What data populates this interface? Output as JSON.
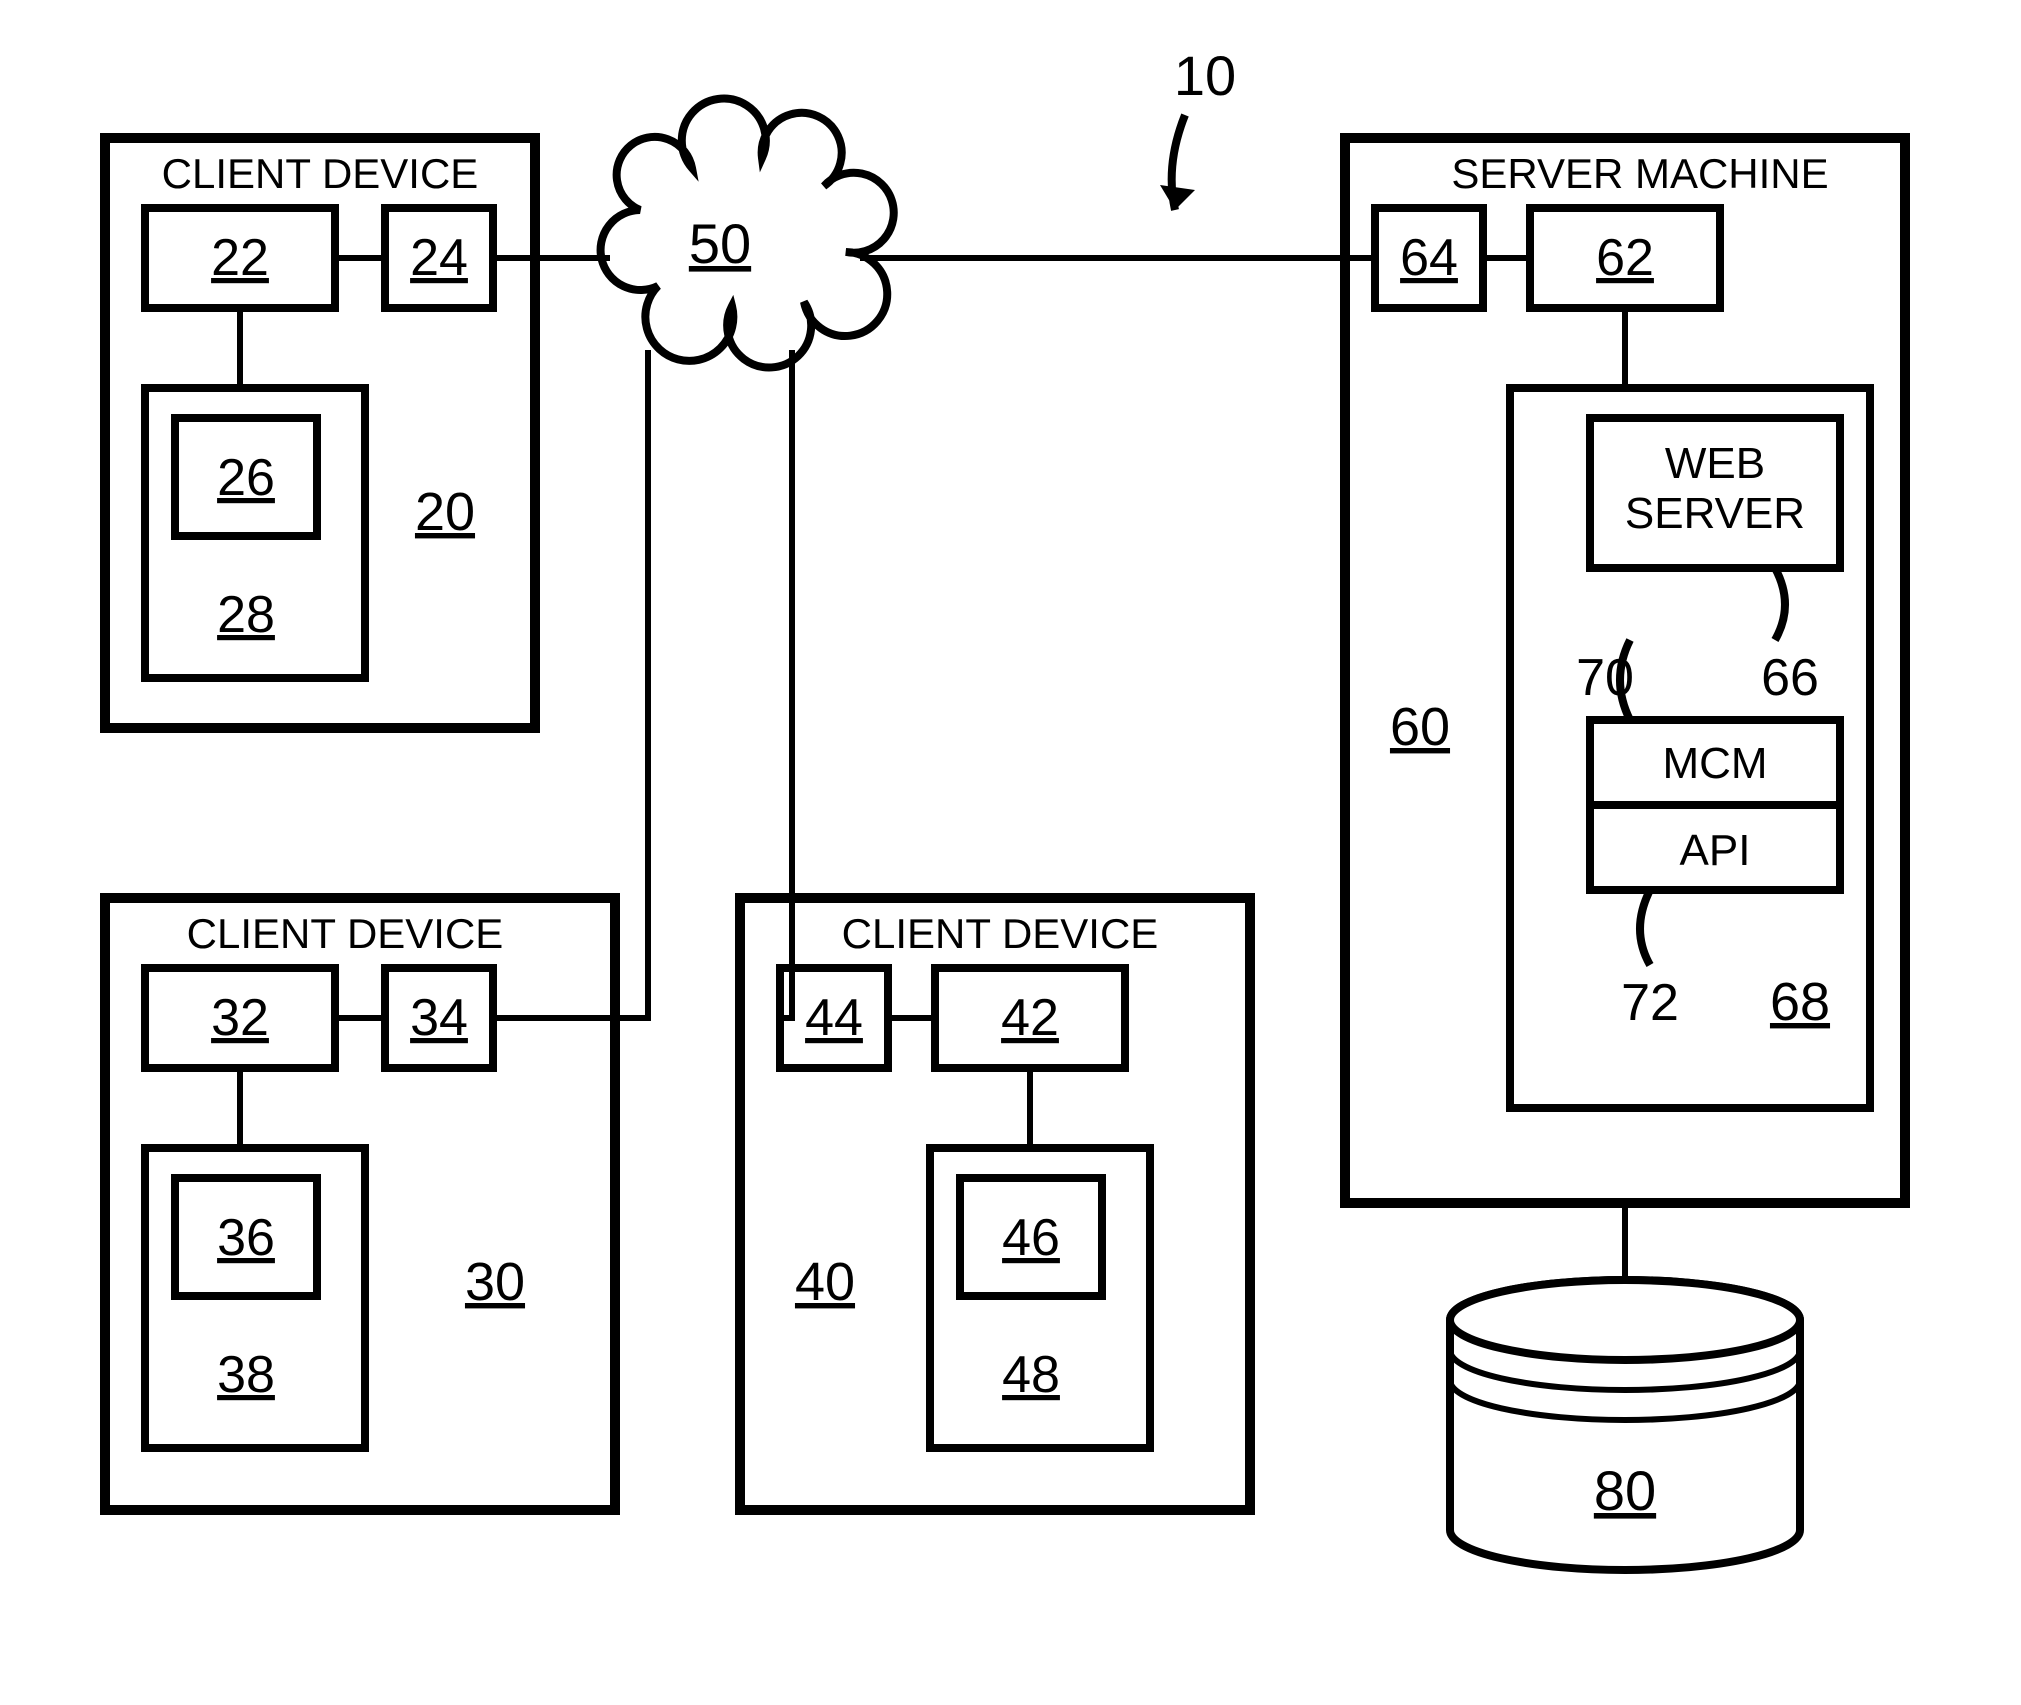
{
  "diagram_ref": "10",
  "client1": {
    "title": "CLIENT DEVICE",
    "box_ref": "20",
    "n22": "22",
    "n24": "24",
    "n26": "26",
    "n28": "28"
  },
  "client2": {
    "title": "CLIENT DEVICE",
    "box_ref": "30",
    "n32": "32",
    "n34": "34",
    "n36": "36",
    "n38": "38"
  },
  "client3": {
    "title": "CLIENT DEVICE",
    "box_ref": "40",
    "n42": "42",
    "n44": "44",
    "n46": "46",
    "n48": "48"
  },
  "cloud": {
    "ref": "50"
  },
  "server": {
    "title": "SERVER MACHINE",
    "box_ref": "60",
    "n62": "62",
    "n64": "64",
    "web_server_label": "WEB SERVER",
    "n66": "66",
    "inner_box_ref": "68",
    "mcm_label": "MCM",
    "n70": "70",
    "api_label": "API",
    "n72": "72"
  },
  "database": {
    "ref": "80"
  }
}
